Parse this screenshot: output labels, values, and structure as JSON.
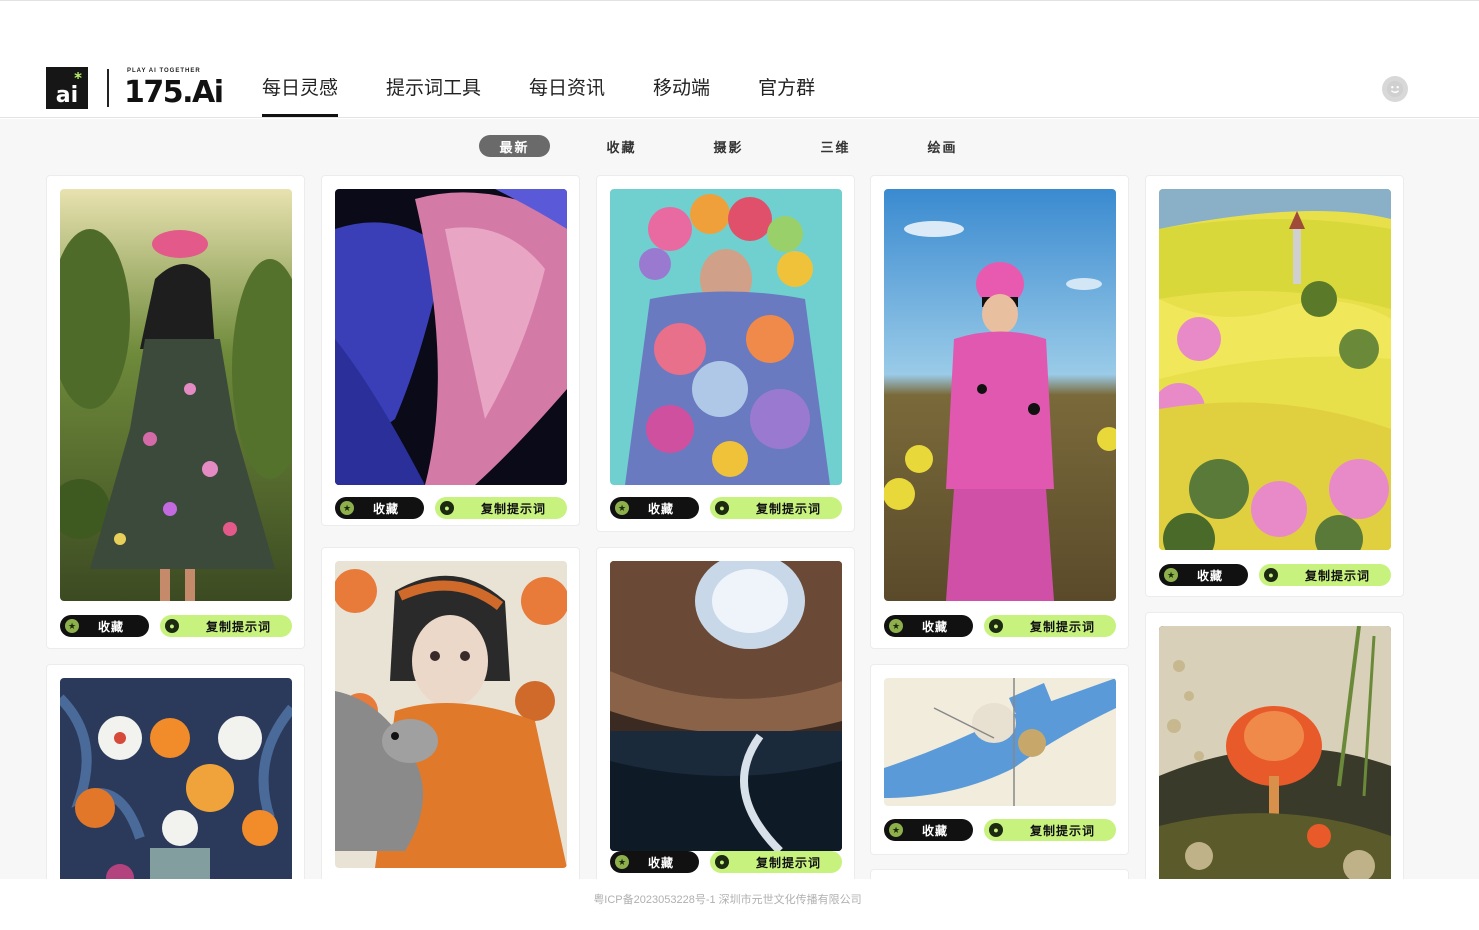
{
  "brand": {
    "logo_text": "ai",
    "tagline": "PLAY AI TOGETHER",
    "name": "175.Ai"
  },
  "nav": [
    {
      "label": "每日灵感",
      "active": true
    },
    {
      "label": "提示词工具",
      "active": false
    },
    {
      "label": "每日资讯",
      "active": false
    },
    {
      "label": "移动端",
      "active": false
    },
    {
      "label": "官方群",
      "active": false
    }
  ],
  "categories": [
    {
      "label": "最新",
      "active": true
    },
    {
      "label": "收藏",
      "active": false
    },
    {
      "label": "摄影",
      "active": false
    },
    {
      "label": "三维",
      "active": false
    },
    {
      "label": "绘画",
      "active": false
    }
  ],
  "buttons": {
    "favorite": "收藏",
    "copy_prompt": "复制提示词"
  },
  "cards": [
    {
      "image": "woman-floral-dress-garden"
    },
    {
      "image": "pink-blue-flower-petal"
    },
    {
      "image": "yarn-pompom-costume"
    },
    {
      "image": "pink-suit-smiley-field"
    },
    {
      "image": "yellow-pink-landscape-windmill"
    },
    {
      "image": "orchids-vase-painting"
    },
    {
      "image": "girl-with-deer-orange"
    },
    {
      "image": "architecture-skylight-interior"
    },
    {
      "image": "blue-cloak-figure-illustration"
    },
    {
      "image": "orange-glass-flower-bubbles"
    }
  ],
  "footer": {
    "icp": "粤ICP备2023053228号-1 深圳市元世文化传播有限公司"
  },
  "colors": {
    "accent": "#c8f27e",
    "dark": "#111111",
    "active_tab": "#6a6a6a"
  },
  "icons": [
    "logo-icon",
    "avatar-icon",
    "star-icon",
    "leaf-icon"
  ]
}
